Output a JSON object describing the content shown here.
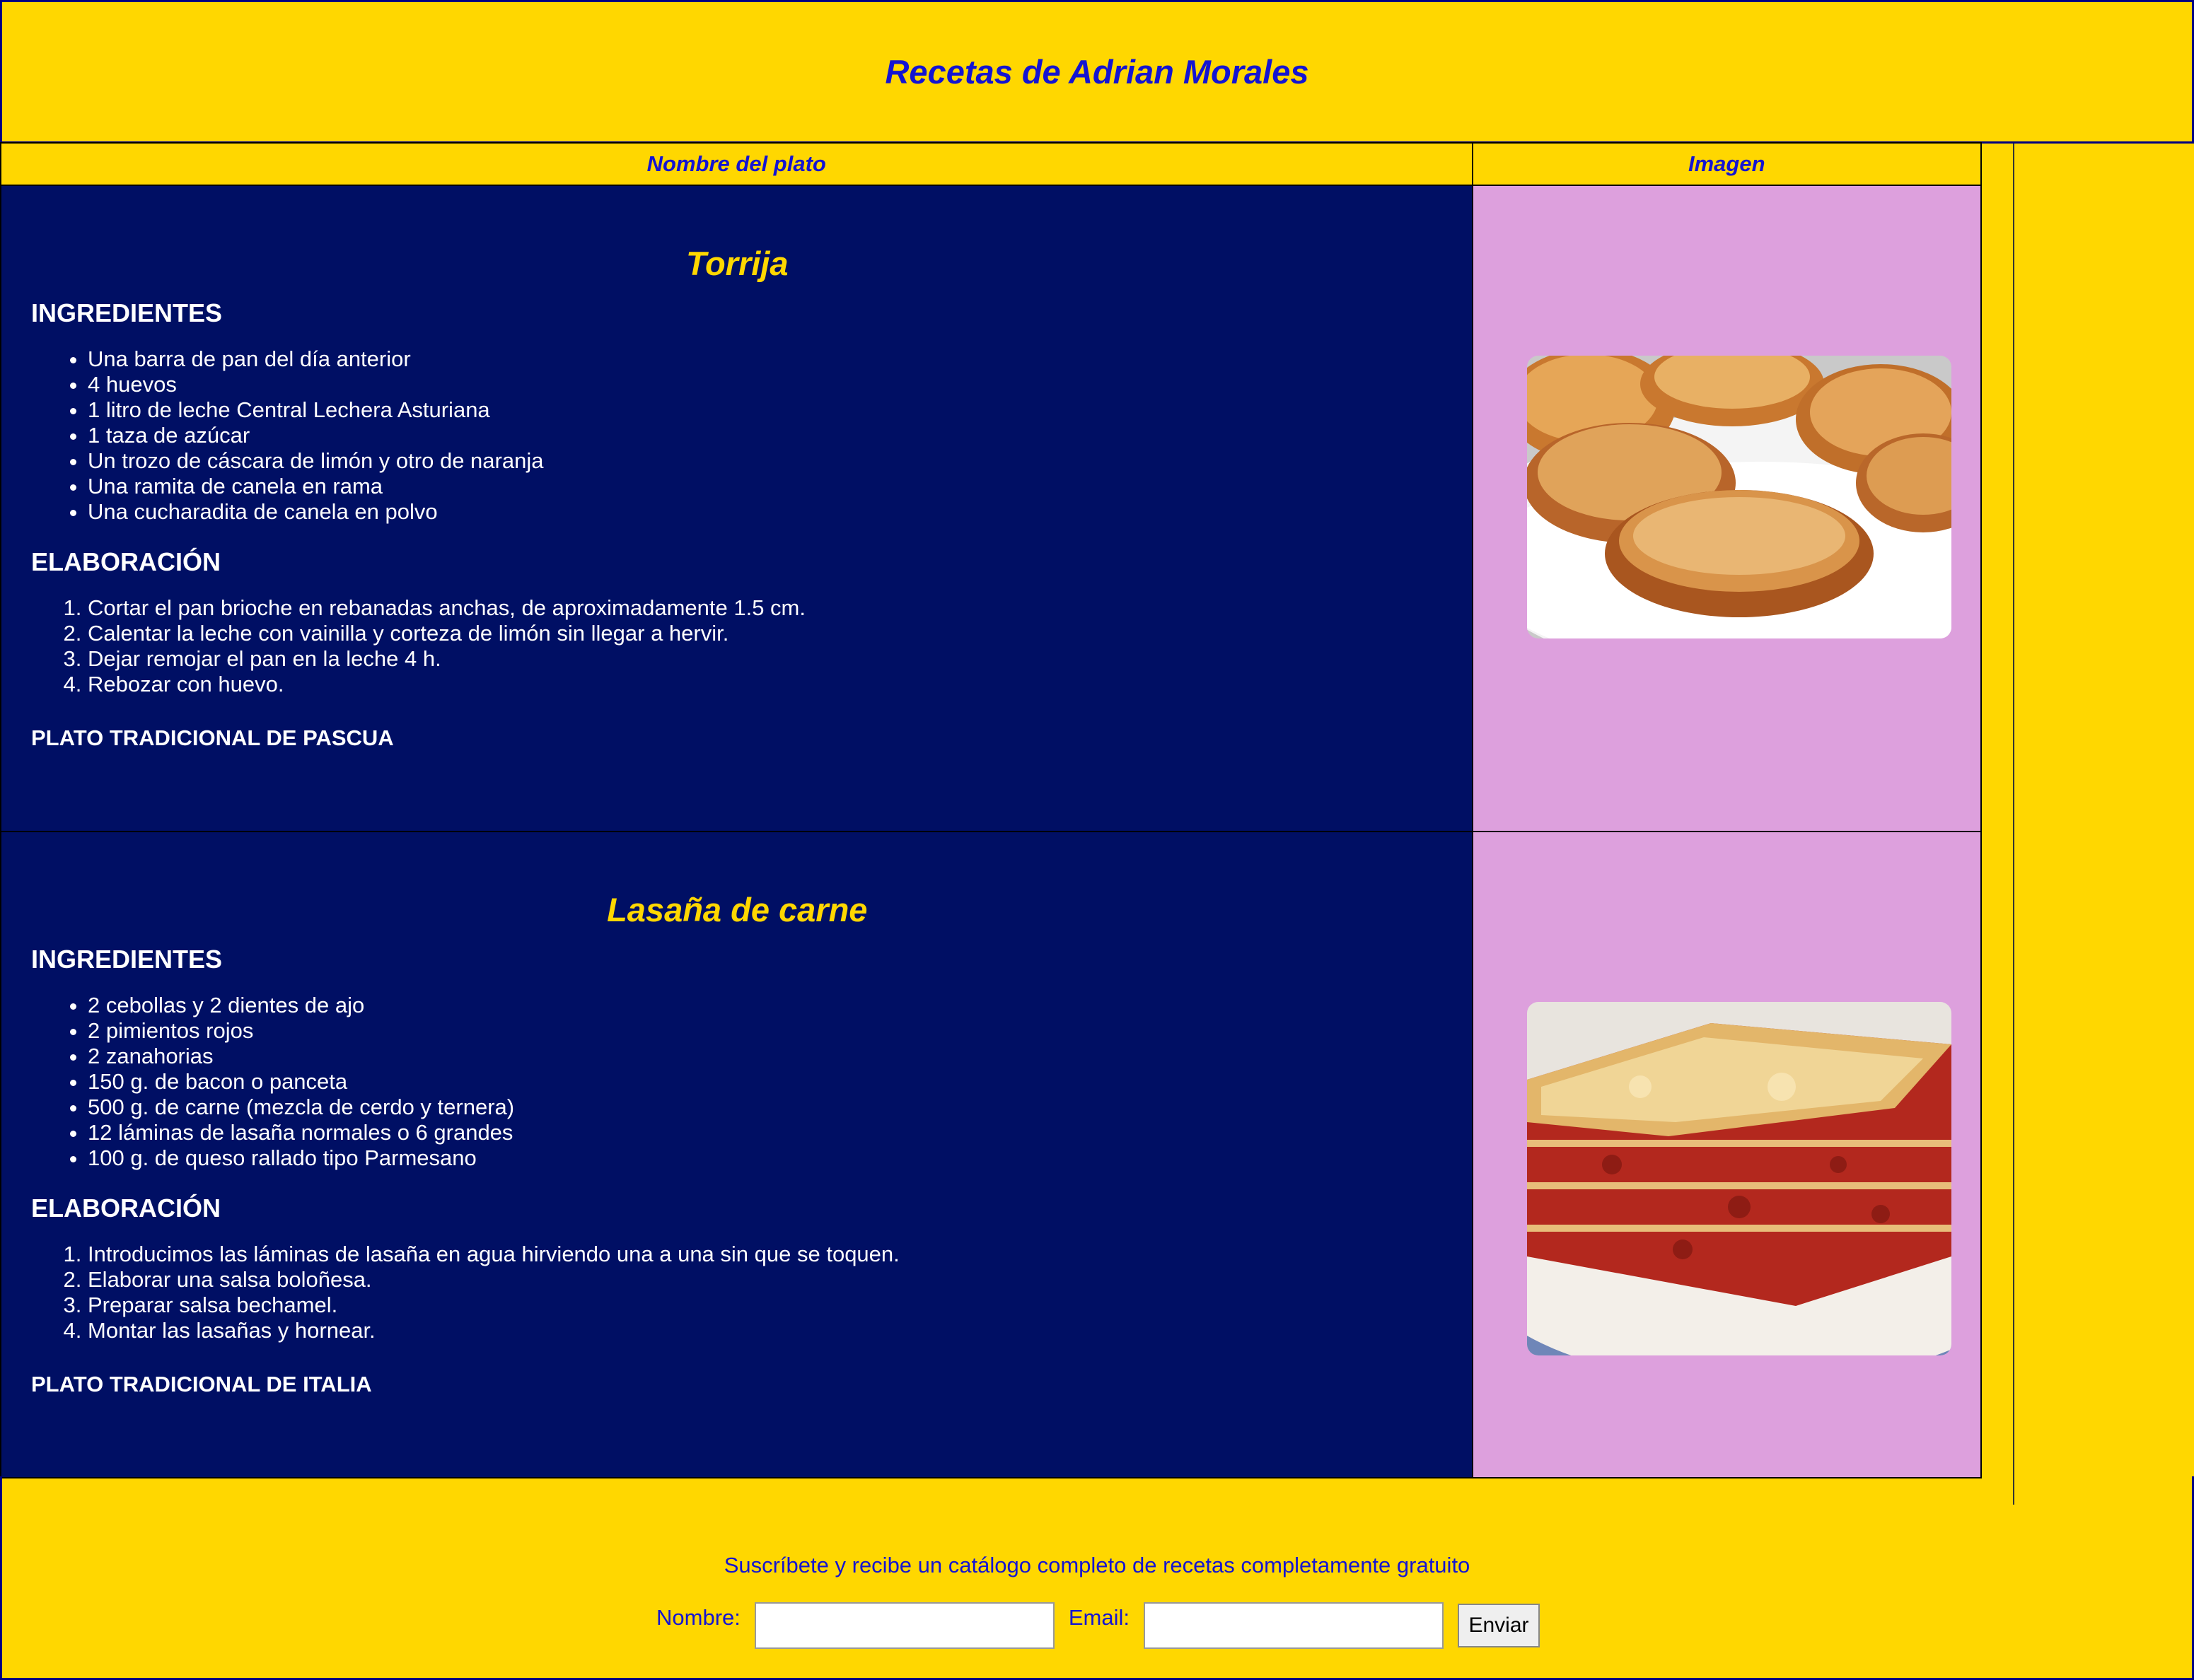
{
  "header": {
    "title": "Recetas de Adrian Morales"
  },
  "table": {
    "col_dish": "Nombre del plato",
    "col_image": "Imagen"
  },
  "recipes": [
    {
      "name": "Torrija",
      "ingredients_title": "INGREDIENTES",
      "ingredients": [
        "Una barra de pan del día anterior",
        "4 huevos",
        "1 litro de leche Central Lechera Asturiana",
        "1 taza de azúcar",
        "Un trozo de cáscara de limón y otro de naranja",
        "Una ramita de canela en rama",
        "Una cucharadita de canela en polvo"
      ],
      "steps_title": "ELABORACIÓN",
      "steps": [
        "Cortar el pan brioche en rebanadas anchas, de aproximadamente 1.5 cm.",
        "Calentar la leche con vainilla y corteza de limón sin llegar a hervir.",
        "Dejar remojar el pan en la leche 4 h.",
        "Rebozar con huevo."
      ],
      "tradition": "PLATO TRADICIONAL DE PASCUA"
    },
    {
      "name": "Lasaña de carne",
      "ingredients_title": "INGREDIENTES",
      "ingredients": [
        "2 cebollas y 2 dientes de ajo",
        "2 pimientos rojos",
        "2 zanahorias",
        "150 g. de bacon o panceta",
        "500 g. de carne (mezcla de cerdo y ternera)",
        "12 láminas de lasaña normales o 6 grandes",
        "100 g. de queso rallado tipo Parmesano"
      ],
      "steps_title": "ELABORACIÓN",
      "steps": [
        "Introducimos las láminas de lasaña en agua hirviendo una a una sin que se toquen.",
        "Elaborar una salsa boloñesa.",
        "Preparar salsa bechamel.",
        "Montar las lasañas y hornear."
      ],
      "tradition": "PLATO TRADICIONAL DE ITALIA"
    }
  ],
  "footer": {
    "message": "Suscríbete y recibe un catálogo completo de recetas completamente gratuito",
    "name_label": "Nombre:",
    "email_label": "Email:",
    "name_value": "",
    "email_value": "",
    "submit_label": "Enviar"
  },
  "colors": {
    "page_bg": "#FFD700",
    "accent_blue": "#1414D2",
    "recipe_bg": "#000F64",
    "image_cell_bg": "#DDA0DD"
  }
}
